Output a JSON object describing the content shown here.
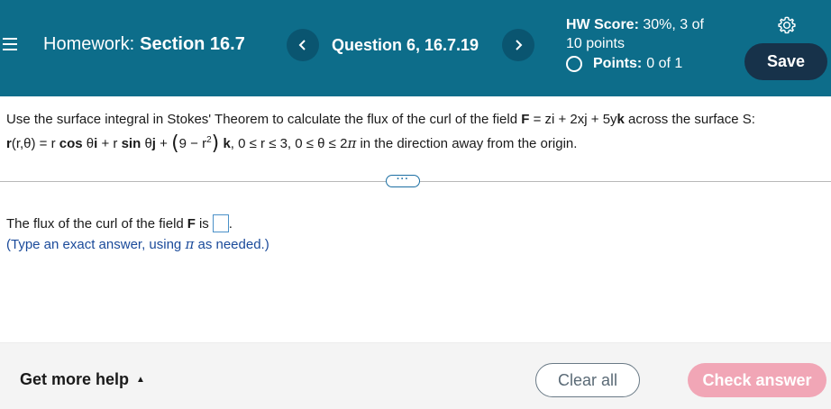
{
  "header": {
    "homework_label": "Homework:",
    "section": "Section 16.7",
    "question": "Question 6, 16.7.19",
    "hw_score_label": "HW Score:",
    "hw_score_line1": "30%, 3 of",
    "hw_score_line2": "10 points",
    "points_label": "Points:",
    "points_value": "0 of 1",
    "save_label": "Save",
    "colors": {
      "background": "#0d6d8a",
      "save_button": "#17324a",
      "nav_button": "#0a5570"
    }
  },
  "question": {
    "intro": "Use the surface integral in Stokes' Theorem to calculate the flux of the curl of the field ",
    "field_F": "F",
    "field_expr_1": " = zi + 2xj + 5y",
    "field_k": "k",
    "intro_end": " across the surface S:",
    "r_bold": "r",
    "r_args": "(r,θ) = r ",
    "cos": "cos",
    "theta_i_1": " θ",
    "i_bold": "i",
    "plus_r": " + r ",
    "sin": "sin",
    "theta_j_1": " θ",
    "j_bold": "j",
    "plus": " + ",
    "paren_open": "(",
    "nine_minus_r": "9 − r",
    "sq": "2",
    "paren_close": ")",
    "k_bold": "k",
    "bounds_1": ", 0 ≤ r ≤ 3, 0 ≤ θ ≤ 2",
    "pi": "π",
    "bounds_2": " in the direction away from the origin."
  },
  "more_button": "···",
  "answer": {
    "prefix": "The flux of the curl of the field",
    "F": "F",
    "is": "is",
    "period": ".",
    "hint_1": "(Type an exact answer, using ",
    "hint_pi": "π",
    "hint_2": " as needed.)"
  },
  "footer": {
    "help_label": "Get more help",
    "help_caret": "▲",
    "clear_label": "Clear all",
    "check_label": "Check answer",
    "colors": {
      "check_button": "#f1a6b6"
    }
  }
}
